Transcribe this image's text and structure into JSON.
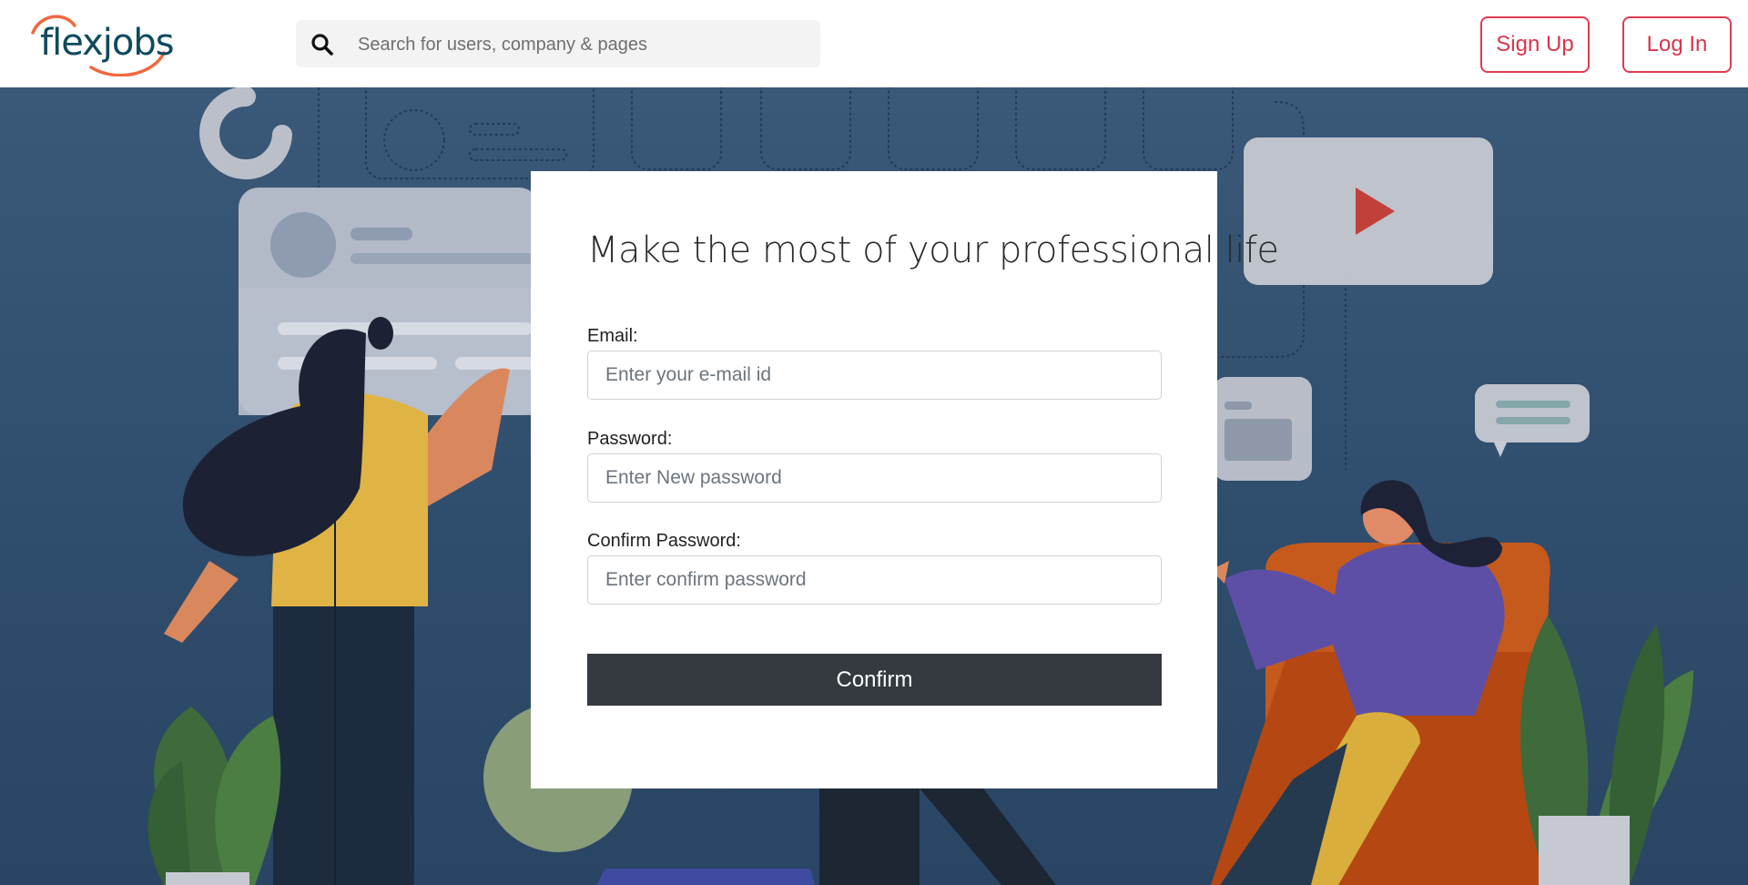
{
  "header": {
    "logo_text": "flexjobs",
    "search_placeholder": "Search for users, company & pages",
    "signup_label": "Sign Up",
    "login_label": "Log In"
  },
  "form": {
    "title": "Make the most of your professional life",
    "email_label": "Email:",
    "email_placeholder": "Enter your e-mail id",
    "password_label": "Password:",
    "password_placeholder": "Enter New password",
    "confirm_label": "Confirm Password:",
    "confirm_placeholder": "Enter confirm password",
    "confirm_button": "Confirm"
  },
  "colors": {
    "accent": "#d8344c",
    "logo": "#0f4a5e",
    "logo_arc": "#ee6a3f",
    "hero_bg": "#34526f",
    "button_dark": "#343a40"
  },
  "icons": {
    "search": "magnifier-icon",
    "play": "play-icon"
  }
}
